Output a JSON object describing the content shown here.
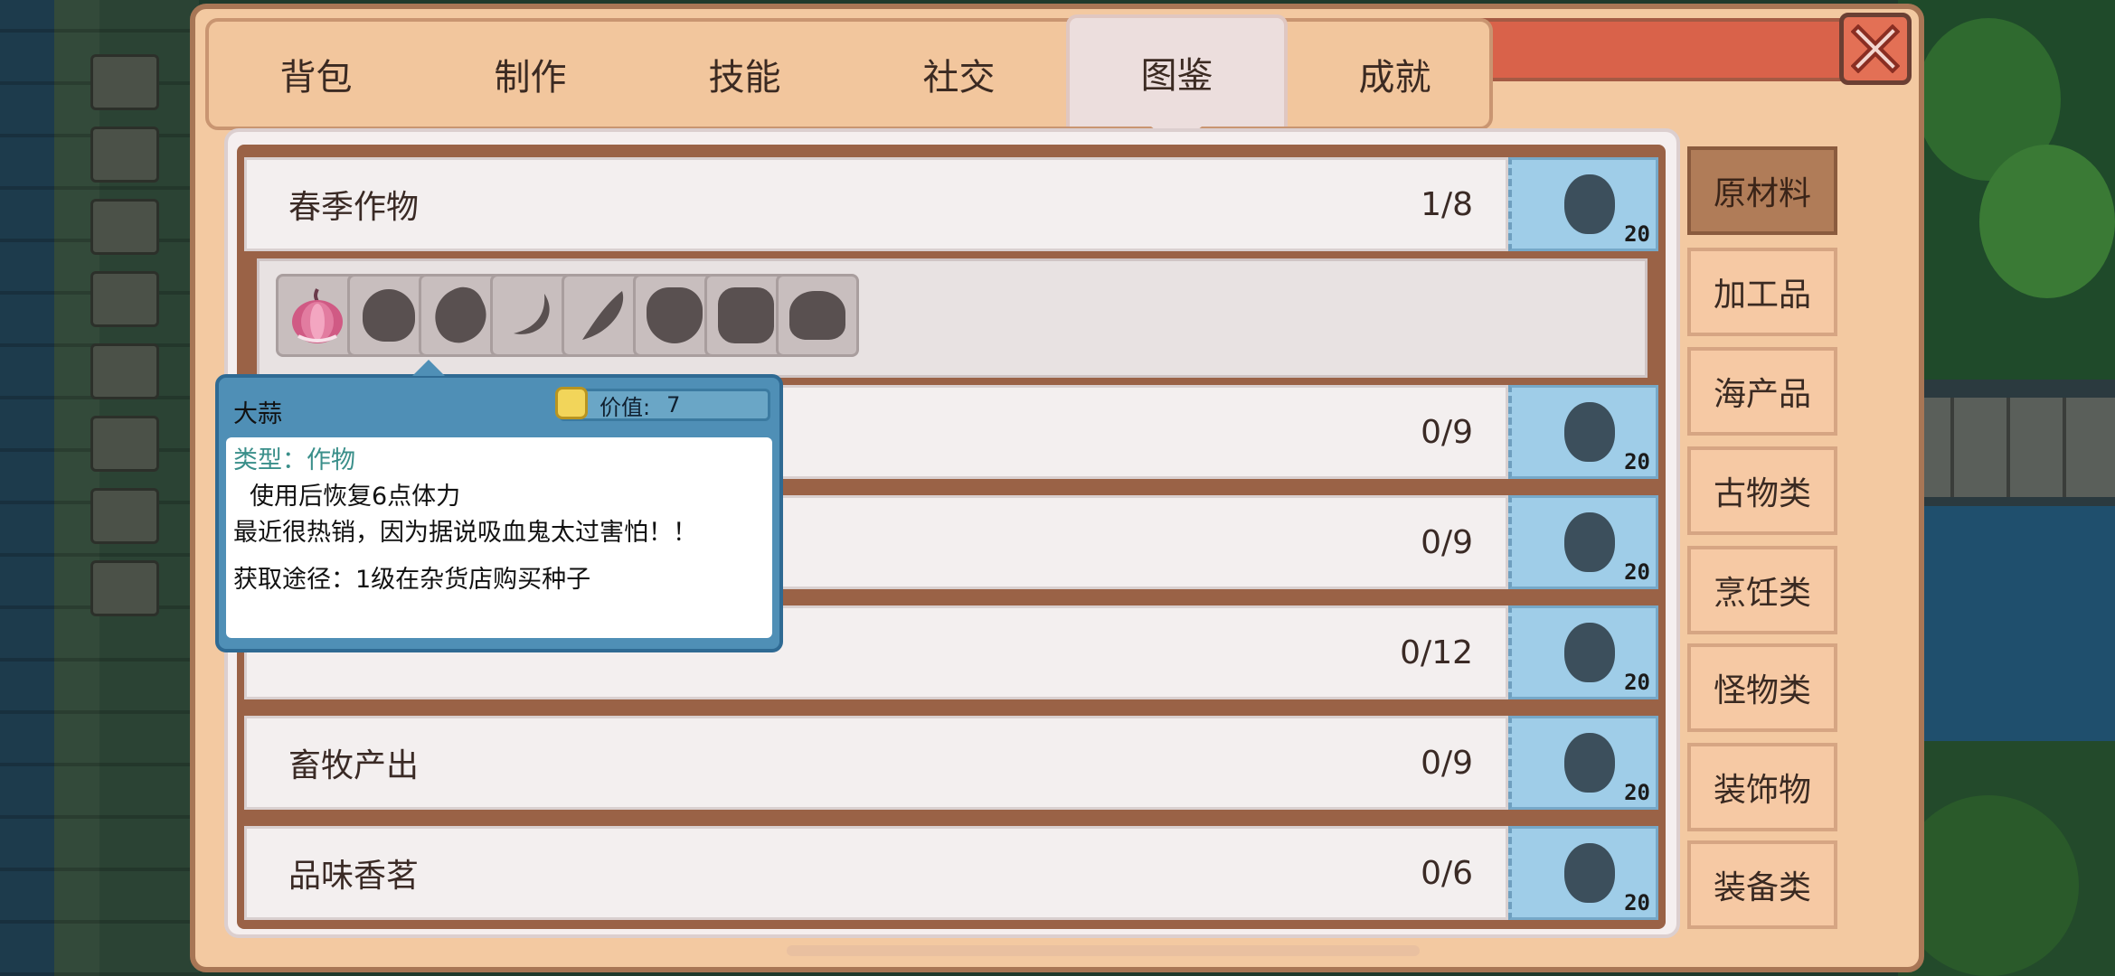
{
  "tabs": [
    {
      "label": "背包"
    },
    {
      "label": "制作"
    },
    {
      "label": "技能"
    },
    {
      "label": "社交"
    },
    {
      "label": "图鉴",
      "active": true
    },
    {
      "label": "成就"
    }
  ],
  "categories": [
    {
      "label": "原材料",
      "active": true
    },
    {
      "label": "加工品"
    },
    {
      "label": "海产品"
    },
    {
      "label": "古物类"
    },
    {
      "label": "烹饪类"
    },
    {
      "label": "怪物类"
    },
    {
      "label": "装饰物"
    },
    {
      "label": "装备类"
    }
  ],
  "rows": [
    {
      "name": "春季作物",
      "progress": "1/8",
      "reward": "20"
    },
    {
      "name": "",
      "progress": "0/9",
      "reward": "20"
    },
    {
      "name": "",
      "progress": "0/9",
      "reward": "20"
    },
    {
      "name": "",
      "progress": "0/12",
      "reward": "20"
    },
    {
      "name": "畜牧产出",
      "progress": "0/9",
      "reward": "20"
    },
    {
      "name": "品味香茗",
      "progress": "0/6",
      "reward": "20"
    }
  ],
  "items": [
    {
      "icon": "garlic-icon",
      "discovered": true
    },
    {
      "icon": "locked-item-icon",
      "discovered": false
    },
    {
      "icon": "locked-item-icon",
      "discovered": false
    },
    {
      "icon": "locked-item-icon",
      "discovered": false
    },
    {
      "icon": "locked-item-icon",
      "discovered": false
    },
    {
      "icon": "locked-item-icon",
      "discovered": false
    },
    {
      "icon": "locked-item-icon",
      "discovered": false
    },
    {
      "icon": "locked-item-icon",
      "discovered": false
    }
  ],
  "tooltip": {
    "title": "大蒜",
    "value_label": "价值:",
    "value": "7",
    "type": "类型：作物",
    "effect": "使用后恢复6点体力",
    "description": "最近很热销，因为据说吸血鬼太过害怕！！",
    "source": "获取途径：1级在杂货店购买种子"
  },
  "colors": {
    "window_bg": "#f3c9a1",
    "accent_red": "#d9624a",
    "badge_blue": "#9fcde8",
    "category_active": "#b07c58"
  }
}
